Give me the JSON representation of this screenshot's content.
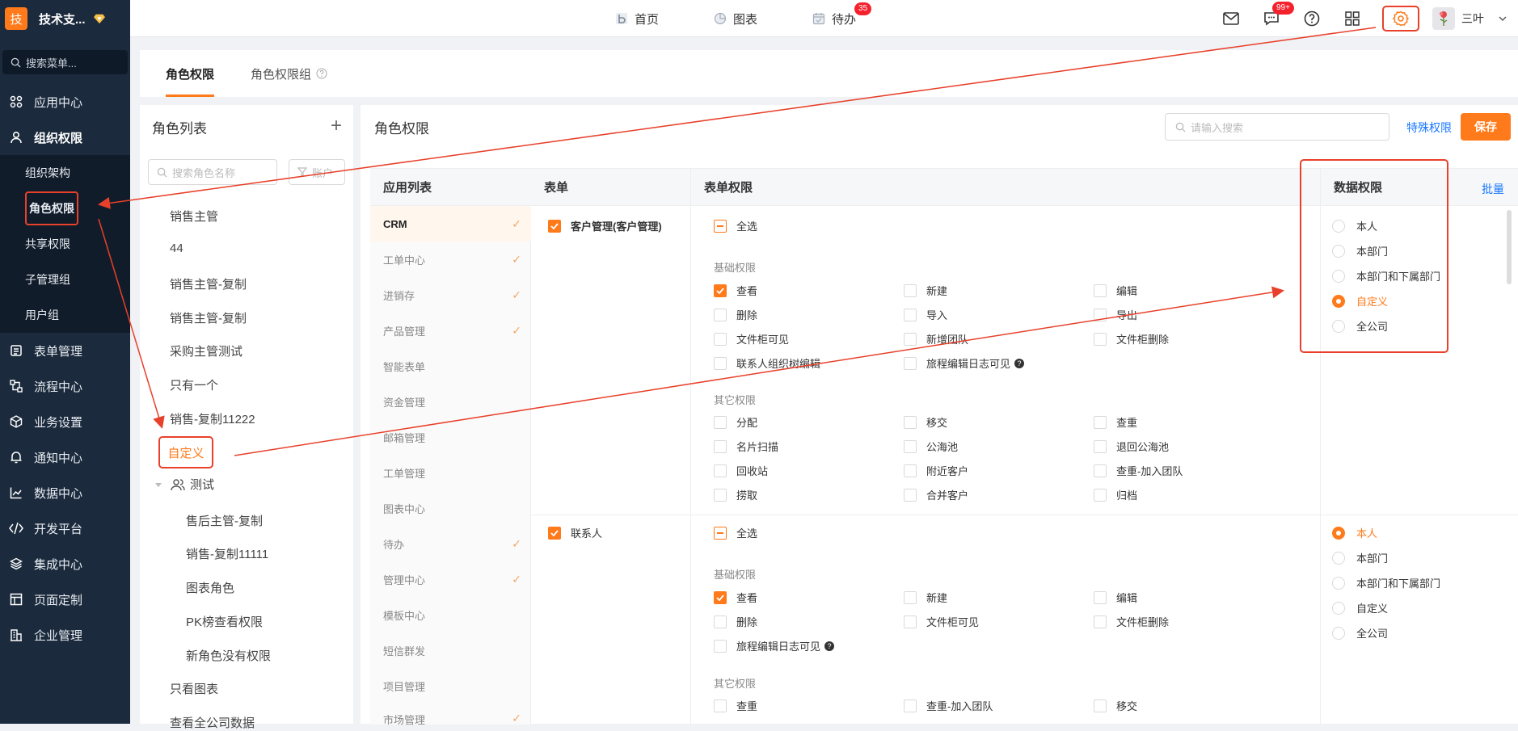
{
  "sidebar": {
    "logo_char": "技",
    "app_name": "技术支...",
    "search_placeholder": "搜索菜单...",
    "menu": [
      {
        "label": "应用中心",
        "icon": "grid-icon"
      },
      {
        "label": "组织权限",
        "icon": "user-icon"
      },
      {
        "label": "表单管理",
        "icon": "form-icon"
      },
      {
        "label": "流程中心",
        "icon": "flow-icon"
      },
      {
        "label": "业务设置",
        "icon": "cube-icon"
      },
      {
        "label": "通知中心",
        "icon": "bell-icon"
      },
      {
        "label": "数据中心",
        "icon": "chart-icon"
      },
      {
        "label": "开发平台",
        "icon": "code-icon"
      },
      {
        "label": "集成中心",
        "icon": "layers-icon"
      },
      {
        "label": "页面定制",
        "icon": "layout-icon"
      },
      {
        "label": "企业管理",
        "icon": "building-icon"
      }
    ],
    "submenu": [
      "组织架构",
      "角色权限",
      "共享权限",
      "子管理组",
      "用户组"
    ]
  },
  "topbar": {
    "nav": [
      {
        "label": "首页"
      },
      {
        "label": "图表"
      },
      {
        "label": "待办",
        "badge": "35"
      }
    ],
    "message_badge": "99+",
    "user_name": "三叶"
  },
  "tabs": {
    "role_permission": "角色权限",
    "role_group": "角色权限组"
  },
  "role_list": {
    "title": "角色列表",
    "search_placeholder": "搜索角色名称",
    "filter_label": "账户",
    "roles": [
      "销售主管",
      "44",
      "销售主管-复制",
      "销售主管-复制",
      "采购主管测试",
      "只有一个",
      "销售-复制11222"
    ],
    "highlighted_role": "自定义",
    "group_name": "测试",
    "group_roles": [
      "售后主管-复制",
      "销售-复制11111",
      "图表角色",
      "PK榜查看权限",
      "新角色没有权限"
    ],
    "after_roles": [
      "只看图表",
      "查看全公司数据"
    ]
  },
  "main": {
    "title": "角色权限",
    "search_placeholder": "请输入搜索",
    "special_label": "特殊权限",
    "save_label": "保存",
    "headers": {
      "apps": "应用列表",
      "form": "表单",
      "perm": "表单权限",
      "data": "数据权限",
      "bulk": "批量"
    },
    "apps": [
      "CRM",
      "工单中心",
      "进销存",
      "产品管理",
      "智能表单",
      "资金管理",
      "邮箱管理",
      "工单管理",
      "图表中心",
      "待办",
      "管理中心",
      "模板中心",
      "短信群发",
      "项目管理",
      "市场管理"
    ],
    "apps_checked": [
      true,
      true,
      true,
      true,
      false,
      false,
      false,
      false,
      false,
      true,
      true,
      false,
      false,
      false,
      true
    ],
    "select_all": "全选",
    "basic_label": "基础权限",
    "other_label": "其它权限",
    "form1": {
      "name": "客户管理(客户管理)",
      "basic": [
        "查看",
        "新建",
        "编辑",
        "删除",
        "导入",
        "导出",
        "文件柜可见",
        "新增团队",
        "文件柜删除",
        "联系人组织树编辑",
        "旅程编辑日志可见"
      ],
      "other": [
        "分配",
        "移交",
        "查重",
        "名片扫描",
        "公海池",
        "退回公海池",
        "回收站",
        "附近客户",
        "查重-加入团队",
        "捞取",
        "合并客户",
        "归档"
      ]
    },
    "form2": {
      "name": "联系人",
      "basic": [
        "查看",
        "新建",
        "编辑",
        "删除",
        "文件柜可见",
        "文件柜删除",
        "旅程编辑日志可见"
      ],
      "other": [
        "查重",
        "查重-加入团队",
        "移交"
      ]
    },
    "data_options": [
      "本人",
      "本部门",
      "本部门和下属部门",
      "自定义",
      "全公司"
    ]
  }
}
